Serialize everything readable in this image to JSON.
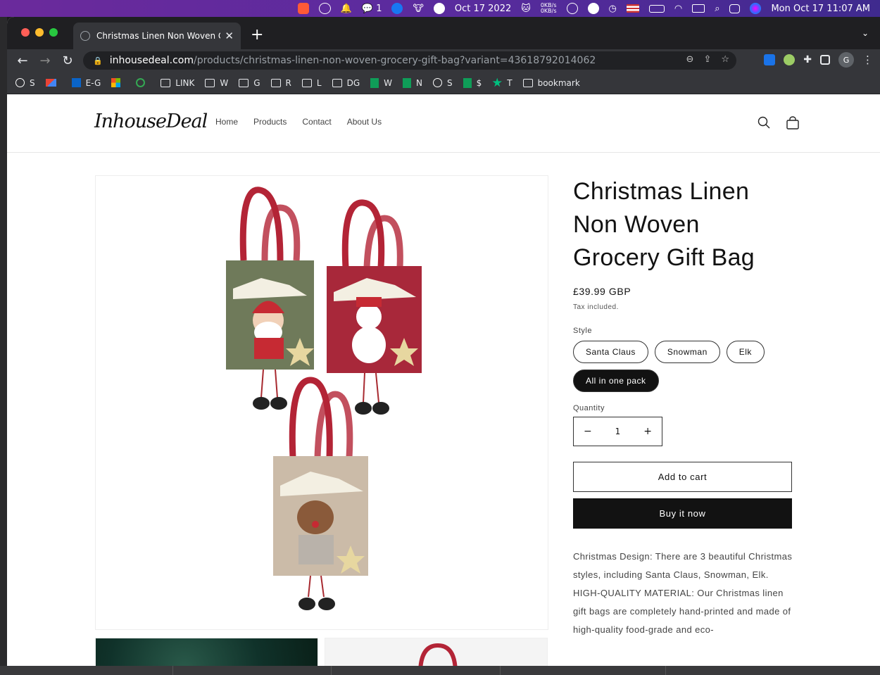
{
  "menubar": {
    "date_item": "Oct 17 2022",
    "wechat_count": "1",
    "net_up": "0KB/s",
    "net_down": "0KB/s",
    "clock": "Mon Oct 17  11:07 AM"
  },
  "browser": {
    "tab_title": "Christmas Linen Non Woven Gr",
    "url_host": "inhousedeal.com",
    "url_path": "/products/christmas-linen-non-woven-grocery-gift-bag?variant=43618792014062",
    "profile_initial": "G",
    "bookmarks": [
      {
        "icon": "globe-icon",
        "label": "S"
      },
      {
        "icon": "gmail-icon",
        "label": ""
      },
      {
        "icon": "outlook-icon",
        "label": "E-G"
      },
      {
        "icon": "microsoft-icon",
        "label": ""
      },
      {
        "icon": "google-icon",
        "label": ""
      },
      {
        "icon": "folder-icon",
        "label": "LINK"
      },
      {
        "icon": "folder-icon",
        "label": "W"
      },
      {
        "icon": "folder-icon",
        "label": "G"
      },
      {
        "icon": "folder-icon",
        "label": "R"
      },
      {
        "icon": "folder-icon",
        "label": "L"
      },
      {
        "icon": "folder-icon",
        "label": "DG"
      },
      {
        "icon": "sheets-plus-icon",
        "label": "W"
      },
      {
        "icon": "sheets-plus-icon",
        "label": "N"
      },
      {
        "icon": "globe-icon",
        "label": "S"
      },
      {
        "icon": "sheets-plus-icon",
        "label": "$"
      },
      {
        "icon": "star-icon",
        "label": "T"
      },
      {
        "icon": "folder-icon",
        "label": "bookmark"
      }
    ]
  },
  "site": {
    "logo": "InhouseDeal",
    "nav": [
      "Home",
      "Products",
      "Contact",
      "About Us"
    ]
  },
  "product": {
    "title": "Christmas Linen Non Woven Grocery Gift Bag",
    "price": "£39.99 GBP",
    "tax_note": "Tax included.",
    "style_label": "Style",
    "styles": [
      "Santa Claus",
      "Snowman",
      "Elk",
      "All in one pack"
    ],
    "selected_style": "All in one pack",
    "quantity_label": "Quantity",
    "quantity": "1",
    "minus": "−",
    "plus": "+",
    "add_to_cart": "Add to cart",
    "buy_now": "Buy it now",
    "description": [
      "Christmas Design: There are 3 beautiful Christmas styles, including Santa Claus, Snowman, Elk.",
      "HIGH-QUALITY MATERIAL: Our Christmas linen gift bags are completely hand-printed and made of high-quality food-grade and eco-"
    ]
  },
  "colors": {
    "brand_dark": "#121212",
    "bag_green": "#6f7a5a",
    "bag_red": "#a8283a",
    "bag_beige": "#cbbba8",
    "handle_red": "#b32436"
  }
}
